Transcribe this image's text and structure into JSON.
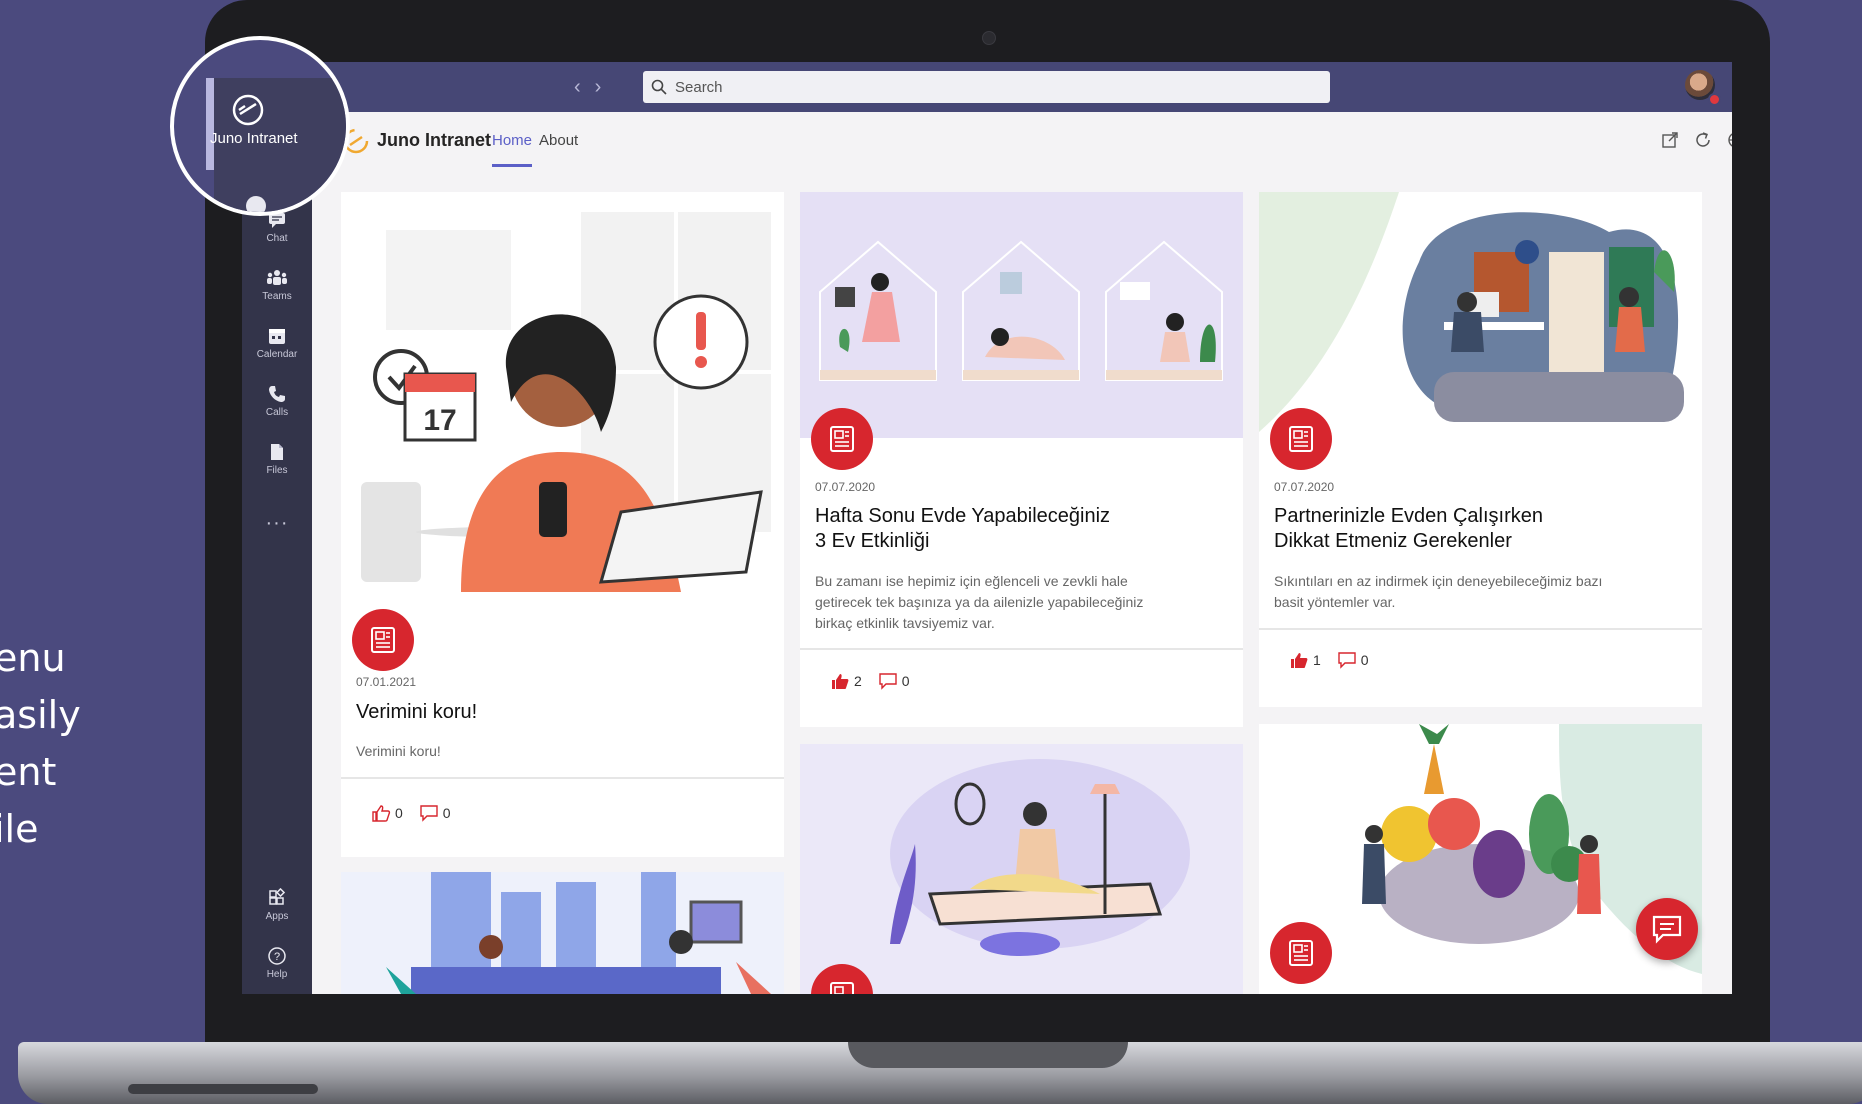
{
  "side_caption": [
    "enu",
    "asily",
    "ent",
    "ile"
  ],
  "search": {
    "placeholder": "Search"
  },
  "rail": {
    "app_label": "Juno Intranet",
    "items": [
      {
        "label": "Chat",
        "icon": "chat-icon"
      },
      {
        "label": "Teams",
        "icon": "teams-icon"
      },
      {
        "label": "Calendar",
        "icon": "calendar-icon"
      },
      {
        "label": "Calls",
        "icon": "phone-icon"
      },
      {
        "label": "Files",
        "icon": "files-icon"
      },
      {
        "label": "Apps",
        "icon": "apps-icon"
      },
      {
        "label": "Help",
        "icon": "help-icon"
      }
    ],
    "more": "···"
  },
  "app": {
    "title": "Juno Intranet",
    "tabs": [
      {
        "label": "Home",
        "active": true
      },
      {
        "label": "About",
        "active": false
      }
    ]
  },
  "cards": [
    {
      "date": "07.01.2021",
      "title": "Verimini koru!",
      "excerpt": "Verimini koru!",
      "likes": "0",
      "comments": "0"
    },
    {
      "date": "07.07.2020",
      "title_line1": "Hafta Sonu Evde Yapabileceğiniz",
      "title_line2": "3 Ev Etkinliği",
      "excerpt_line1": "Bu zamanı ise hepimiz için eğlenceli ve zevkli hale",
      "excerpt_line2": "getirecek tek başınıza ya da ailenizle yapabileceğiniz",
      "excerpt_line3": "birkaç etkinlik tavsiyemiz var.",
      "likes": "2",
      "comments": "0"
    },
    {
      "date": "07.07.2020",
      "title_line1": "Partnerinizle Evden Çalışırken",
      "title_line2": "Dikkat Etmeniz Gerekenler",
      "excerpt_line1": "Sıkıntıları en az indirmek için deneyebileceğimiz bazı",
      "excerpt_line2": "basit yöntemler var.",
      "likes": "1",
      "comments": "0"
    }
  ],
  "colors": {
    "brand": "#464775",
    "accent": "#5b5fc7",
    "badge": "#d7262e",
    "background": "#4b4a7e"
  }
}
